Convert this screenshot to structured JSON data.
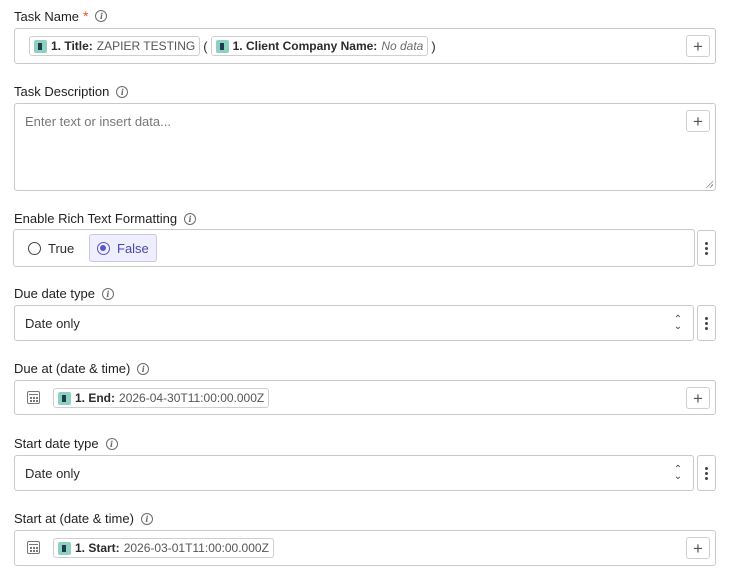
{
  "task_name": {
    "label": "Task Name",
    "required_mark": "*",
    "pills": [
      {
        "label": "1. Title:",
        "value": "ZAPIER TESTING",
        "italic": false
      },
      {
        "label": "1. Client Company Name:",
        "value": "No data",
        "italic": true
      }
    ],
    "open_paren": "(",
    "close_paren": ")"
  },
  "task_description": {
    "label": "Task Description",
    "placeholder": "Enter text or insert data..."
  },
  "rich_text": {
    "label": "Enable Rich Text Formatting",
    "options": [
      {
        "label": "True",
        "selected": false
      },
      {
        "label": "False",
        "selected": true
      }
    ]
  },
  "due_date_type": {
    "label": "Due date type",
    "value": "Date only"
  },
  "due_at": {
    "label": "Due at (date & time)",
    "pill": {
      "label": "1. End:",
      "value": "2026-04-30T11:00:00.000Z"
    }
  },
  "start_date_type": {
    "label": "Start date type",
    "value": "Date only"
  },
  "start_at": {
    "label": "Start at (date & time)",
    "pill": {
      "label": "1. Start:",
      "value": "2026-03-01T11:00:00.000Z"
    }
  },
  "icons": {
    "info": "i",
    "plus": "+",
    "chevron": "⌃⌄"
  },
  "colors": {
    "accent": "#5a55c9",
    "required": "#e4542f",
    "app_icon": "#8fd1c0"
  }
}
